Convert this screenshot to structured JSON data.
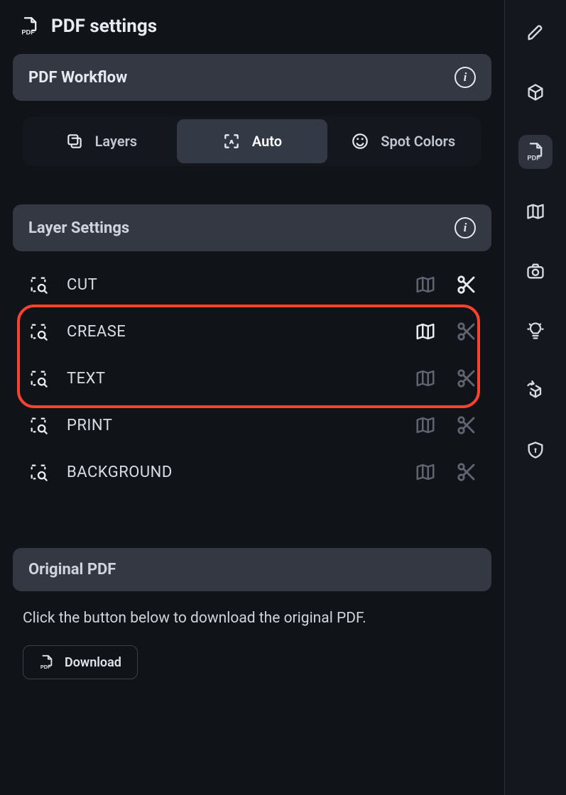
{
  "page": {
    "title": "PDF settings"
  },
  "workflow": {
    "title": "PDF Workflow",
    "tabs": [
      {
        "label": "Layers",
        "icon": "layers-icon",
        "active": false
      },
      {
        "label": "Auto",
        "icon": "focus-icon",
        "active": true
      },
      {
        "label": "Spot Colors",
        "icon": "palette-icon",
        "active": false
      }
    ]
  },
  "layerSettings": {
    "title": "Layer Settings",
    "rows": [
      {
        "name": "CUT",
        "mapActive": false,
        "cutActive": true
      },
      {
        "name": "CREASE",
        "mapActive": true,
        "cutActive": false
      },
      {
        "name": "TEXT",
        "mapActive": false,
        "cutActive": false
      },
      {
        "name": "PRINT",
        "mapActive": false,
        "cutActive": false
      },
      {
        "name": "BACKGROUND",
        "mapActive": false,
        "cutActive": false
      }
    ]
  },
  "originalPdf": {
    "title": "Original PDF",
    "hint": "Click the button below to download the original PDF.",
    "downloadLabel": "Download"
  },
  "sideNav": [
    {
      "name": "edit",
      "icon": "pencil-icon",
      "active": false
    },
    {
      "name": "box",
      "icon": "box-icon",
      "active": false
    },
    {
      "name": "pdf",
      "icon": "pdf-icon",
      "active": true
    },
    {
      "name": "map",
      "icon": "map-icon",
      "active": false
    },
    {
      "name": "camera",
      "icon": "camera-icon",
      "active": false
    },
    {
      "name": "bulb",
      "icon": "bulb-icon",
      "active": false
    },
    {
      "name": "rotate",
      "icon": "rotate-icon",
      "active": false
    },
    {
      "name": "shield",
      "icon": "shield-icon",
      "active": false
    }
  ]
}
